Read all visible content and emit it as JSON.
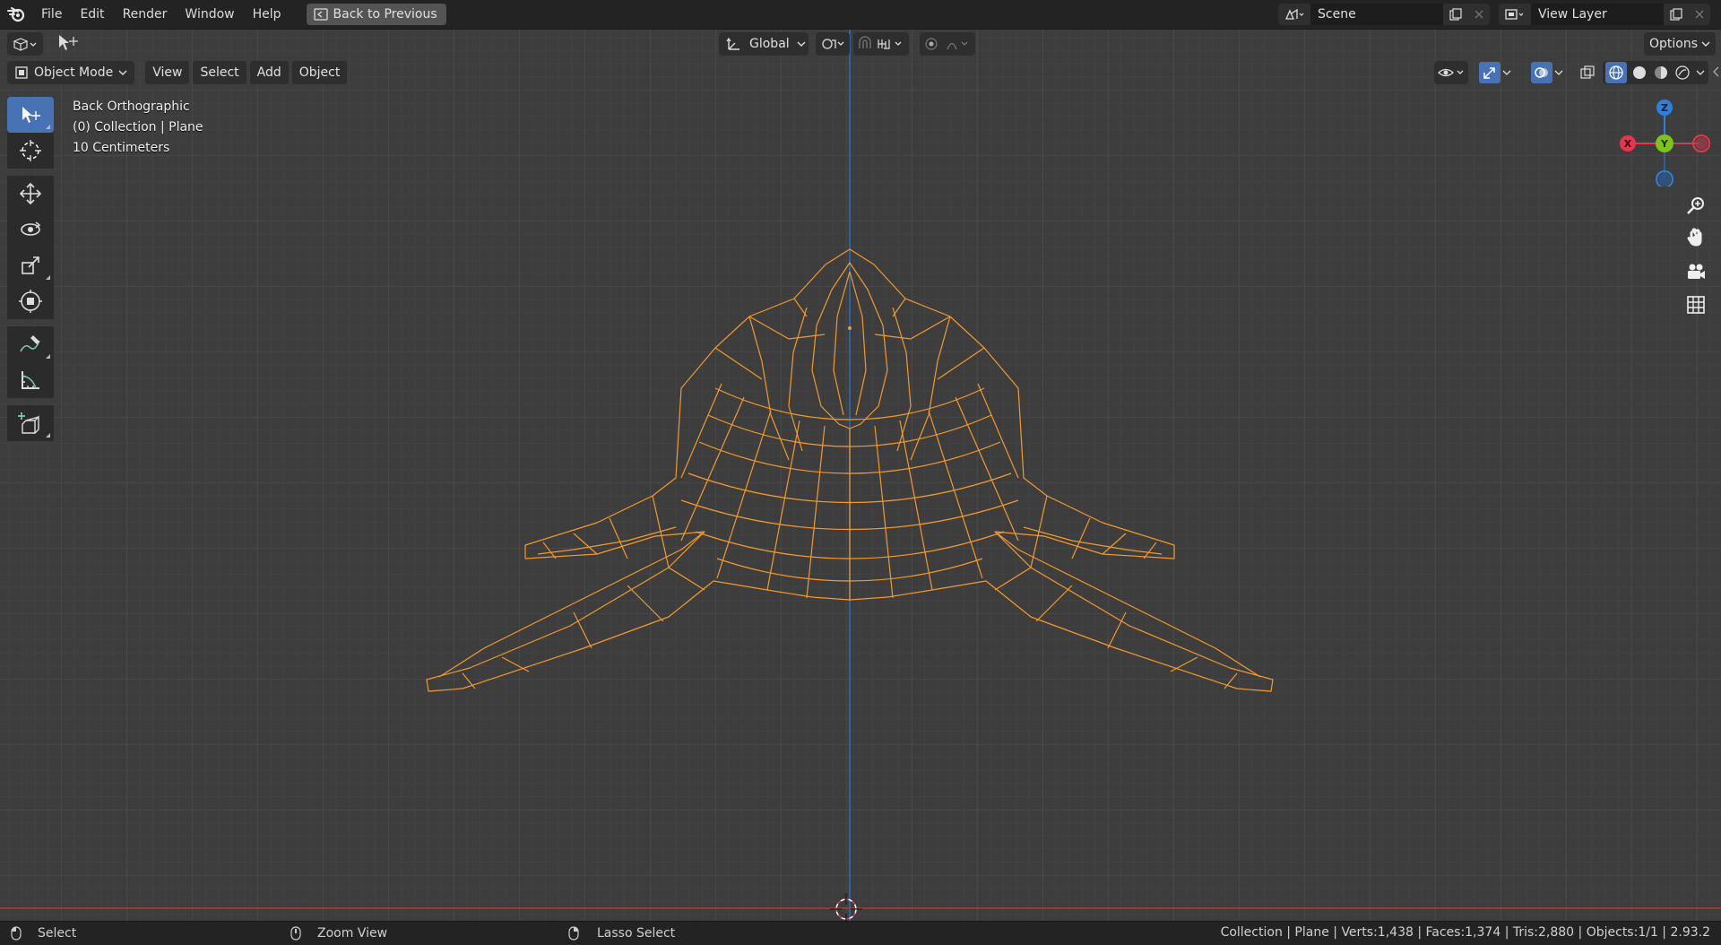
{
  "topbar": {
    "menus": [
      "File",
      "Edit",
      "Render",
      "Window",
      "Help"
    ],
    "back_button": "Back to Previous",
    "scene_name": "Scene",
    "view_layer": "View Layer"
  },
  "tool_header": {
    "transform_orientation": "Global",
    "options": "Options"
  },
  "object_header": {
    "mode": "Object Mode",
    "menus": [
      "View",
      "Select",
      "Add",
      "Object"
    ]
  },
  "viewport_info": {
    "view": "Back Orthographic",
    "collection": "(0) Collection | Plane",
    "scale": "10 Centimeters"
  },
  "gizmo": {
    "x": "X",
    "y": "Y",
    "z": "Z",
    "colors": {
      "x": "#e8344d",
      "y": "#7ec31c",
      "z": "#2e7fd9"
    }
  },
  "statusbar": {
    "select": "Select",
    "zoom": "Zoom View",
    "lasso": "Lasso Select",
    "stats": "Collection | Plane | Verts:1,438 | Faces:1,374 | Tris:2,880 | Objects:1/1 | 2.93.2"
  },
  "colors": {
    "accent": "#4772b3",
    "wire": "#f39a2c",
    "axis_y": "#2e6fbf",
    "axis_x": "#b03a3a"
  }
}
